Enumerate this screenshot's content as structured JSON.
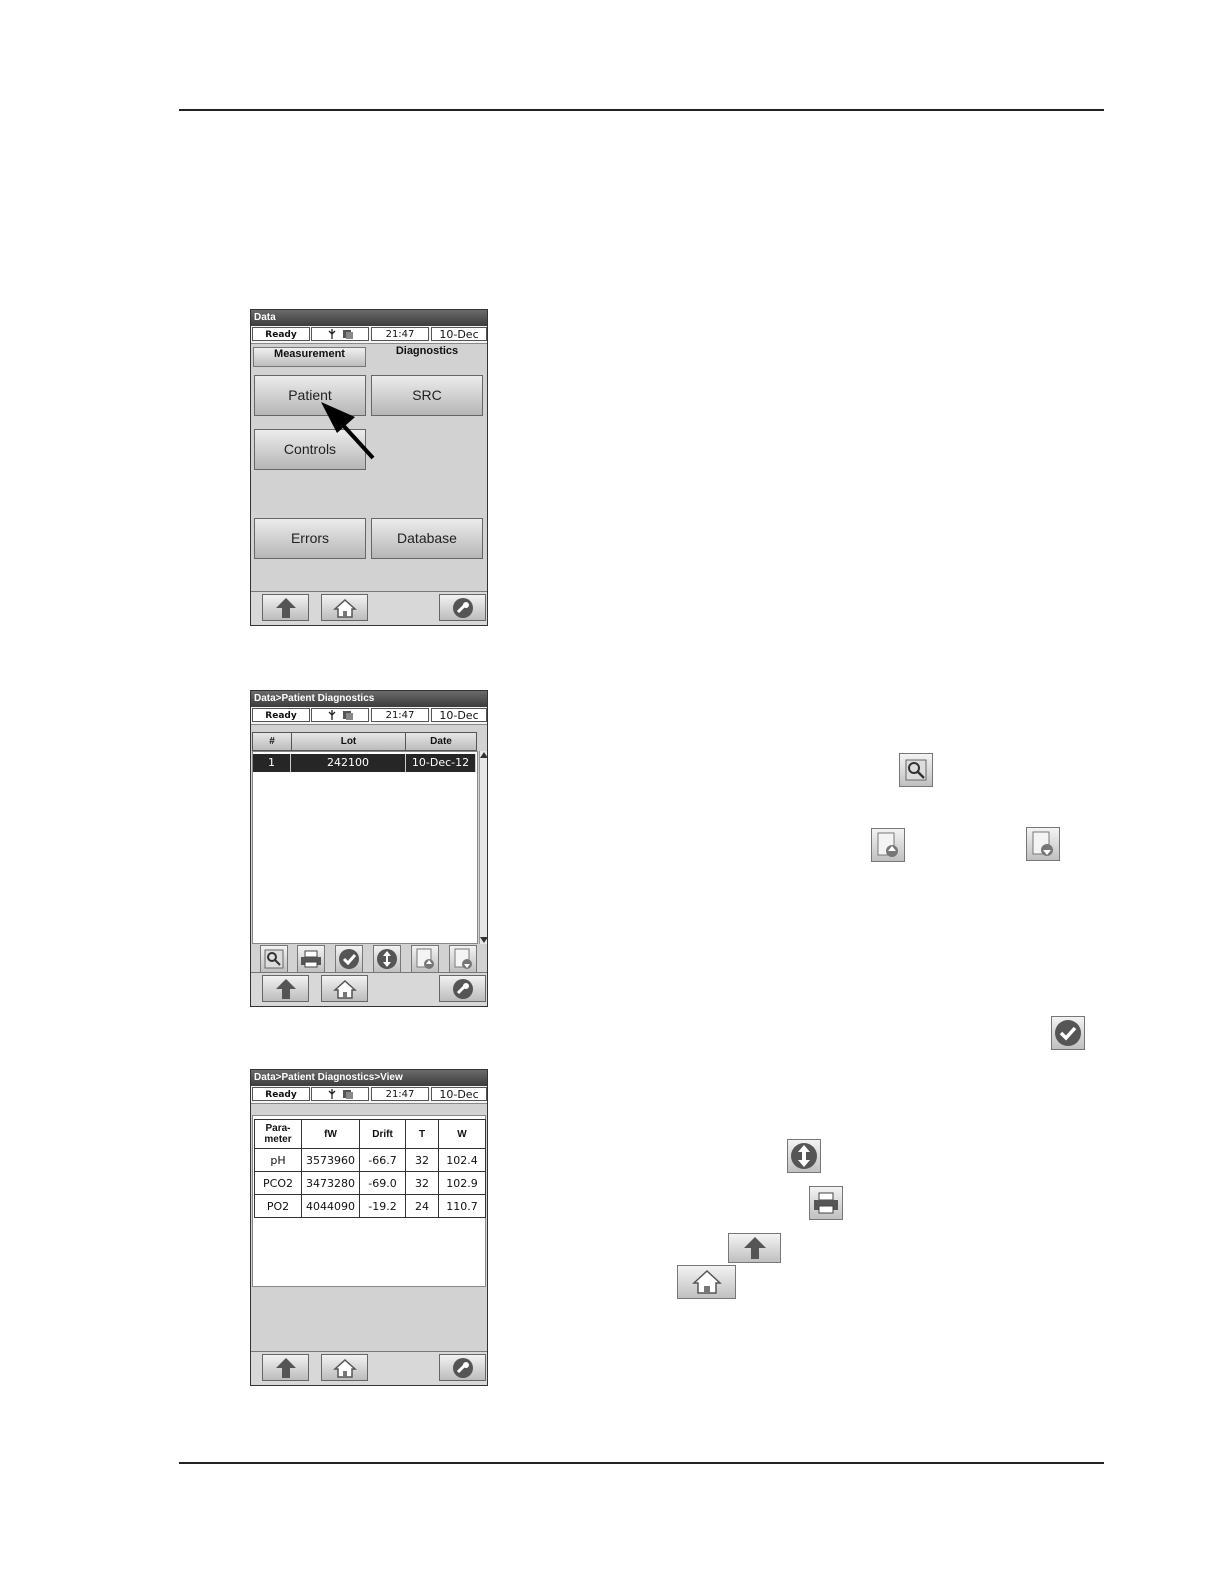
{
  "screen1": {
    "title": "Data",
    "status": {
      "ready": "Ready",
      "time": "21:47",
      "date": "10-Dec"
    },
    "tabs": {
      "measurement": "Measurement",
      "diagnostics": "Diagnostics"
    },
    "buttons": {
      "patient": "Patient",
      "src": "SRC",
      "controls": "Controls",
      "errors": "Errors",
      "database": "Database"
    }
  },
  "screen2": {
    "title": "Data>Patient Diagnostics",
    "status": {
      "ready": "Ready",
      "time": "21:47",
      "date": "10-Dec"
    },
    "columns": [
      "#",
      "Lot",
      "Date"
    ],
    "rows": [
      {
        "num": "1",
        "lot": "242100",
        "date": "10-Dec-12"
      }
    ]
  },
  "screen3": {
    "title": "Data>Patient Diagnostics>View",
    "status": {
      "ready": "Ready",
      "time": "21:47",
      "date": "10-Dec"
    },
    "columns": [
      "Para-meter",
      "fW",
      "Drift",
      "T",
      "W"
    ],
    "rows": [
      [
        "pH",
        "3573960",
        "-66.7",
        "32",
        "102.4"
      ],
      [
        "PCO2",
        "3473280",
        "-69.0",
        "32",
        "102.9"
      ],
      [
        "PO2",
        "4044090",
        "-19.2",
        "24",
        "110.7"
      ]
    ]
  }
}
